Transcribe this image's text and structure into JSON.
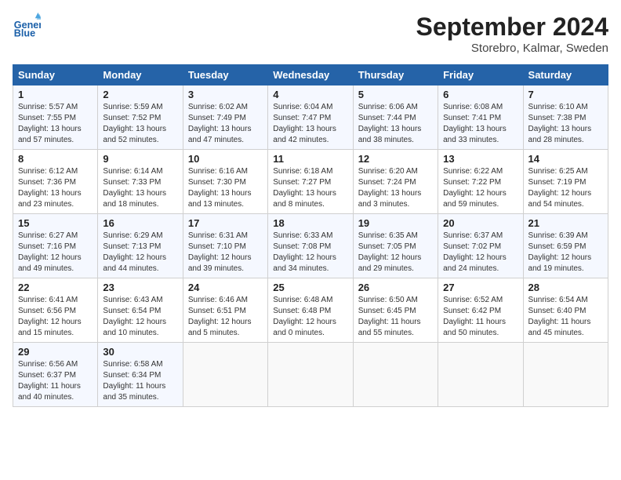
{
  "logo": {
    "line1": "General",
    "line2": "Blue"
  },
  "title": "September 2024",
  "location": "Storebro, Kalmar, Sweden",
  "days_of_week": [
    "Sunday",
    "Monday",
    "Tuesday",
    "Wednesday",
    "Thursday",
    "Friday",
    "Saturday"
  ],
  "weeks": [
    [
      {
        "day": 1,
        "sunrise": "5:57 AM",
        "sunset": "7:55 PM",
        "daylight": "13 hours and 57 minutes."
      },
      {
        "day": 2,
        "sunrise": "5:59 AM",
        "sunset": "7:52 PM",
        "daylight": "13 hours and 52 minutes."
      },
      {
        "day": 3,
        "sunrise": "6:02 AM",
        "sunset": "7:49 PM",
        "daylight": "13 hours and 47 minutes."
      },
      {
        "day": 4,
        "sunrise": "6:04 AM",
        "sunset": "7:47 PM",
        "daylight": "13 hours and 42 minutes."
      },
      {
        "day": 5,
        "sunrise": "6:06 AM",
        "sunset": "7:44 PM",
        "daylight": "13 hours and 38 minutes."
      },
      {
        "day": 6,
        "sunrise": "6:08 AM",
        "sunset": "7:41 PM",
        "daylight": "13 hours and 33 minutes."
      },
      {
        "day": 7,
        "sunrise": "6:10 AM",
        "sunset": "7:38 PM",
        "daylight": "13 hours and 28 minutes."
      }
    ],
    [
      {
        "day": 8,
        "sunrise": "6:12 AM",
        "sunset": "7:36 PM",
        "daylight": "13 hours and 23 minutes."
      },
      {
        "day": 9,
        "sunrise": "6:14 AM",
        "sunset": "7:33 PM",
        "daylight": "13 hours and 18 minutes."
      },
      {
        "day": 10,
        "sunrise": "6:16 AM",
        "sunset": "7:30 PM",
        "daylight": "13 hours and 13 minutes."
      },
      {
        "day": 11,
        "sunrise": "6:18 AM",
        "sunset": "7:27 PM",
        "daylight": "13 hours and 8 minutes."
      },
      {
        "day": 12,
        "sunrise": "6:20 AM",
        "sunset": "7:24 PM",
        "daylight": "13 hours and 3 minutes."
      },
      {
        "day": 13,
        "sunrise": "6:22 AM",
        "sunset": "7:22 PM",
        "daylight": "12 hours and 59 minutes."
      },
      {
        "day": 14,
        "sunrise": "6:25 AM",
        "sunset": "7:19 PM",
        "daylight": "12 hours and 54 minutes."
      }
    ],
    [
      {
        "day": 15,
        "sunrise": "6:27 AM",
        "sunset": "7:16 PM",
        "daylight": "12 hours and 49 minutes."
      },
      {
        "day": 16,
        "sunrise": "6:29 AM",
        "sunset": "7:13 PM",
        "daylight": "12 hours and 44 minutes."
      },
      {
        "day": 17,
        "sunrise": "6:31 AM",
        "sunset": "7:10 PM",
        "daylight": "12 hours and 39 minutes."
      },
      {
        "day": 18,
        "sunrise": "6:33 AM",
        "sunset": "7:08 PM",
        "daylight": "12 hours and 34 minutes."
      },
      {
        "day": 19,
        "sunrise": "6:35 AM",
        "sunset": "7:05 PM",
        "daylight": "12 hours and 29 minutes."
      },
      {
        "day": 20,
        "sunrise": "6:37 AM",
        "sunset": "7:02 PM",
        "daylight": "12 hours and 24 minutes."
      },
      {
        "day": 21,
        "sunrise": "6:39 AM",
        "sunset": "6:59 PM",
        "daylight": "12 hours and 19 minutes."
      }
    ],
    [
      {
        "day": 22,
        "sunrise": "6:41 AM",
        "sunset": "6:56 PM",
        "daylight": "12 hours and 15 minutes."
      },
      {
        "day": 23,
        "sunrise": "6:43 AM",
        "sunset": "6:54 PM",
        "daylight": "12 hours and 10 minutes."
      },
      {
        "day": 24,
        "sunrise": "6:46 AM",
        "sunset": "6:51 PM",
        "daylight": "12 hours and 5 minutes."
      },
      {
        "day": 25,
        "sunrise": "6:48 AM",
        "sunset": "6:48 PM",
        "daylight": "12 hours and 0 minutes."
      },
      {
        "day": 26,
        "sunrise": "6:50 AM",
        "sunset": "6:45 PM",
        "daylight": "11 hours and 55 minutes."
      },
      {
        "day": 27,
        "sunrise": "6:52 AM",
        "sunset": "6:42 PM",
        "daylight": "11 hours and 50 minutes."
      },
      {
        "day": 28,
        "sunrise": "6:54 AM",
        "sunset": "6:40 PM",
        "daylight": "11 hours and 45 minutes."
      }
    ],
    [
      {
        "day": 29,
        "sunrise": "6:56 AM",
        "sunset": "6:37 PM",
        "daylight": "11 hours and 40 minutes."
      },
      {
        "day": 30,
        "sunrise": "6:58 AM",
        "sunset": "6:34 PM",
        "daylight": "11 hours and 35 minutes."
      },
      null,
      null,
      null,
      null,
      null
    ]
  ]
}
